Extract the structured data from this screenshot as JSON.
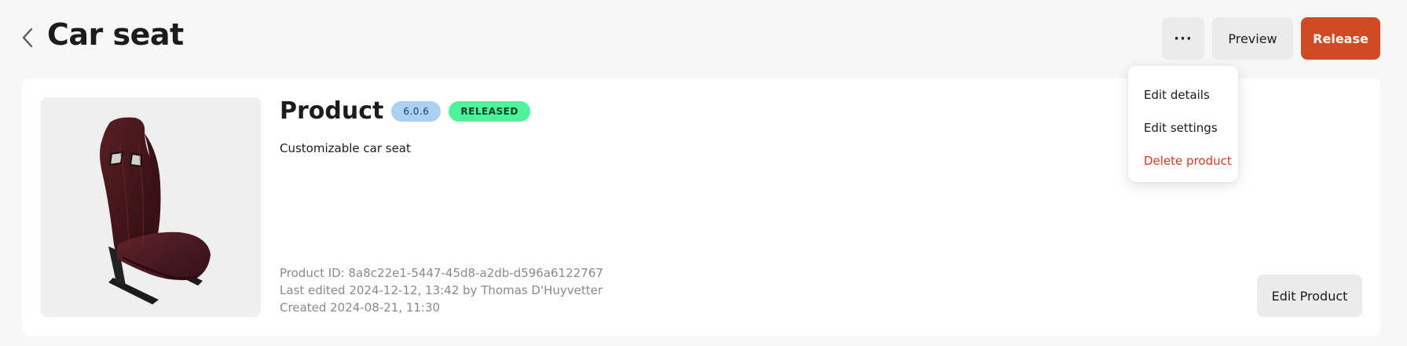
{
  "header": {
    "title": "Car seat",
    "back_icon": "chevron-left-icon",
    "more_label": "···",
    "preview_label": "Preview",
    "release_label": "Release"
  },
  "menu": {
    "items": [
      {
        "label": "Edit details"
      },
      {
        "label": "Edit settings"
      },
      {
        "label": "Delete product"
      }
    ]
  },
  "product": {
    "title": "Product",
    "version": "6.0.6",
    "status": "RELEASED",
    "description": "Customizable car seat",
    "image_icon": "car-seat-image",
    "meta": {
      "id_line": "Product ID: 8a8c22e1-5447-45d8-a2db-d596a6122767",
      "edited_line": "Last edited 2024-12-12, 13:42 by Thomas D'Huyvetter",
      "created_line": "Created 2024-08-21, 11:30"
    },
    "edit_label": "Edit Product"
  },
  "colors": {
    "accent": "#d04a23",
    "danger": "#e0381f",
    "version_badge": "#a9d1f3",
    "status_badge": "#4bf39a"
  }
}
